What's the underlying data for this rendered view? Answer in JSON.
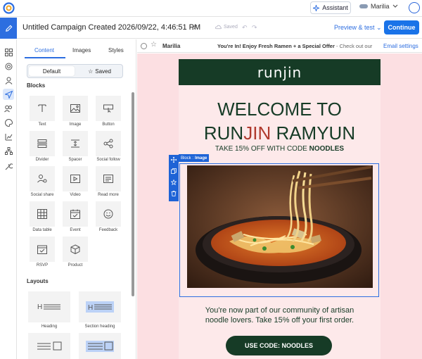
{
  "topbar": {
    "assistant_label": "Assistant",
    "user_name": "Marilia"
  },
  "titlebar": {
    "campaign_title": "Untitled Campaign Created 2026/09/22, 4:46:51 PM",
    "saved_label": "Saved",
    "preview_label": "Preview & test",
    "continue_label": "Continue"
  },
  "panel": {
    "tabs": [
      "Content",
      "Images",
      "Styles"
    ],
    "toggle": {
      "default_label": "Default",
      "saved_label": "Saved"
    },
    "blocks_heading": "Blocks",
    "blocks": [
      {
        "label": "Text",
        "icon": "text-icon"
      },
      {
        "label": "Image",
        "icon": "image-icon"
      },
      {
        "label": "Button",
        "icon": "button-icon"
      },
      {
        "label": "Divider",
        "icon": "divider-icon"
      },
      {
        "label": "Spacer",
        "icon": "spacer-icon"
      },
      {
        "label": "Social follow",
        "icon": "share-icon"
      },
      {
        "label": "Social share",
        "icon": "social-share-icon"
      },
      {
        "label": "Video",
        "icon": "video-icon"
      },
      {
        "label": "Read more",
        "icon": "read-more-icon"
      },
      {
        "label": "Data table",
        "icon": "table-icon"
      },
      {
        "label": "Event",
        "icon": "calendar-icon"
      },
      {
        "label": "Feedback",
        "icon": "smiley-icon"
      },
      {
        "label": "RSVP",
        "icon": "rsvp-icon"
      },
      {
        "label": "Product",
        "icon": "box-icon"
      }
    ],
    "layouts_heading": "Layouts",
    "layouts": [
      {
        "label": "Heading"
      },
      {
        "label": "Section heading"
      }
    ]
  },
  "email_header": {
    "sender": "Marilia",
    "subject": "You're In! Enjoy Fresh Ramen + a Special Offer",
    "preheader": " - Check out our",
    "settings_label": "Email settings"
  },
  "email": {
    "brand": "runjin",
    "welcome_line1": "WELCOME TO",
    "welcome_run": "RUN",
    "welcome_jin": "JIN",
    "welcome_ramyun": " RAMYUN",
    "offer_prefix": "TAKE 15% OFF WITH CODE ",
    "offer_code": "NOODLES",
    "block_tag_prefix": "Block : ",
    "block_tag_name": "Image",
    "copy_line1": "You're now part of our community of artisan",
    "copy_line2": "noodle lovers. Take 15% off your first order.",
    "cta_label": "USE CODE: NOODLES"
  },
  "colors": {
    "brand_green": "#163b26",
    "accent_blue": "#1a73e8",
    "canvas_pink": "#fcdfe2",
    "jin_red": "#b03a2e"
  }
}
